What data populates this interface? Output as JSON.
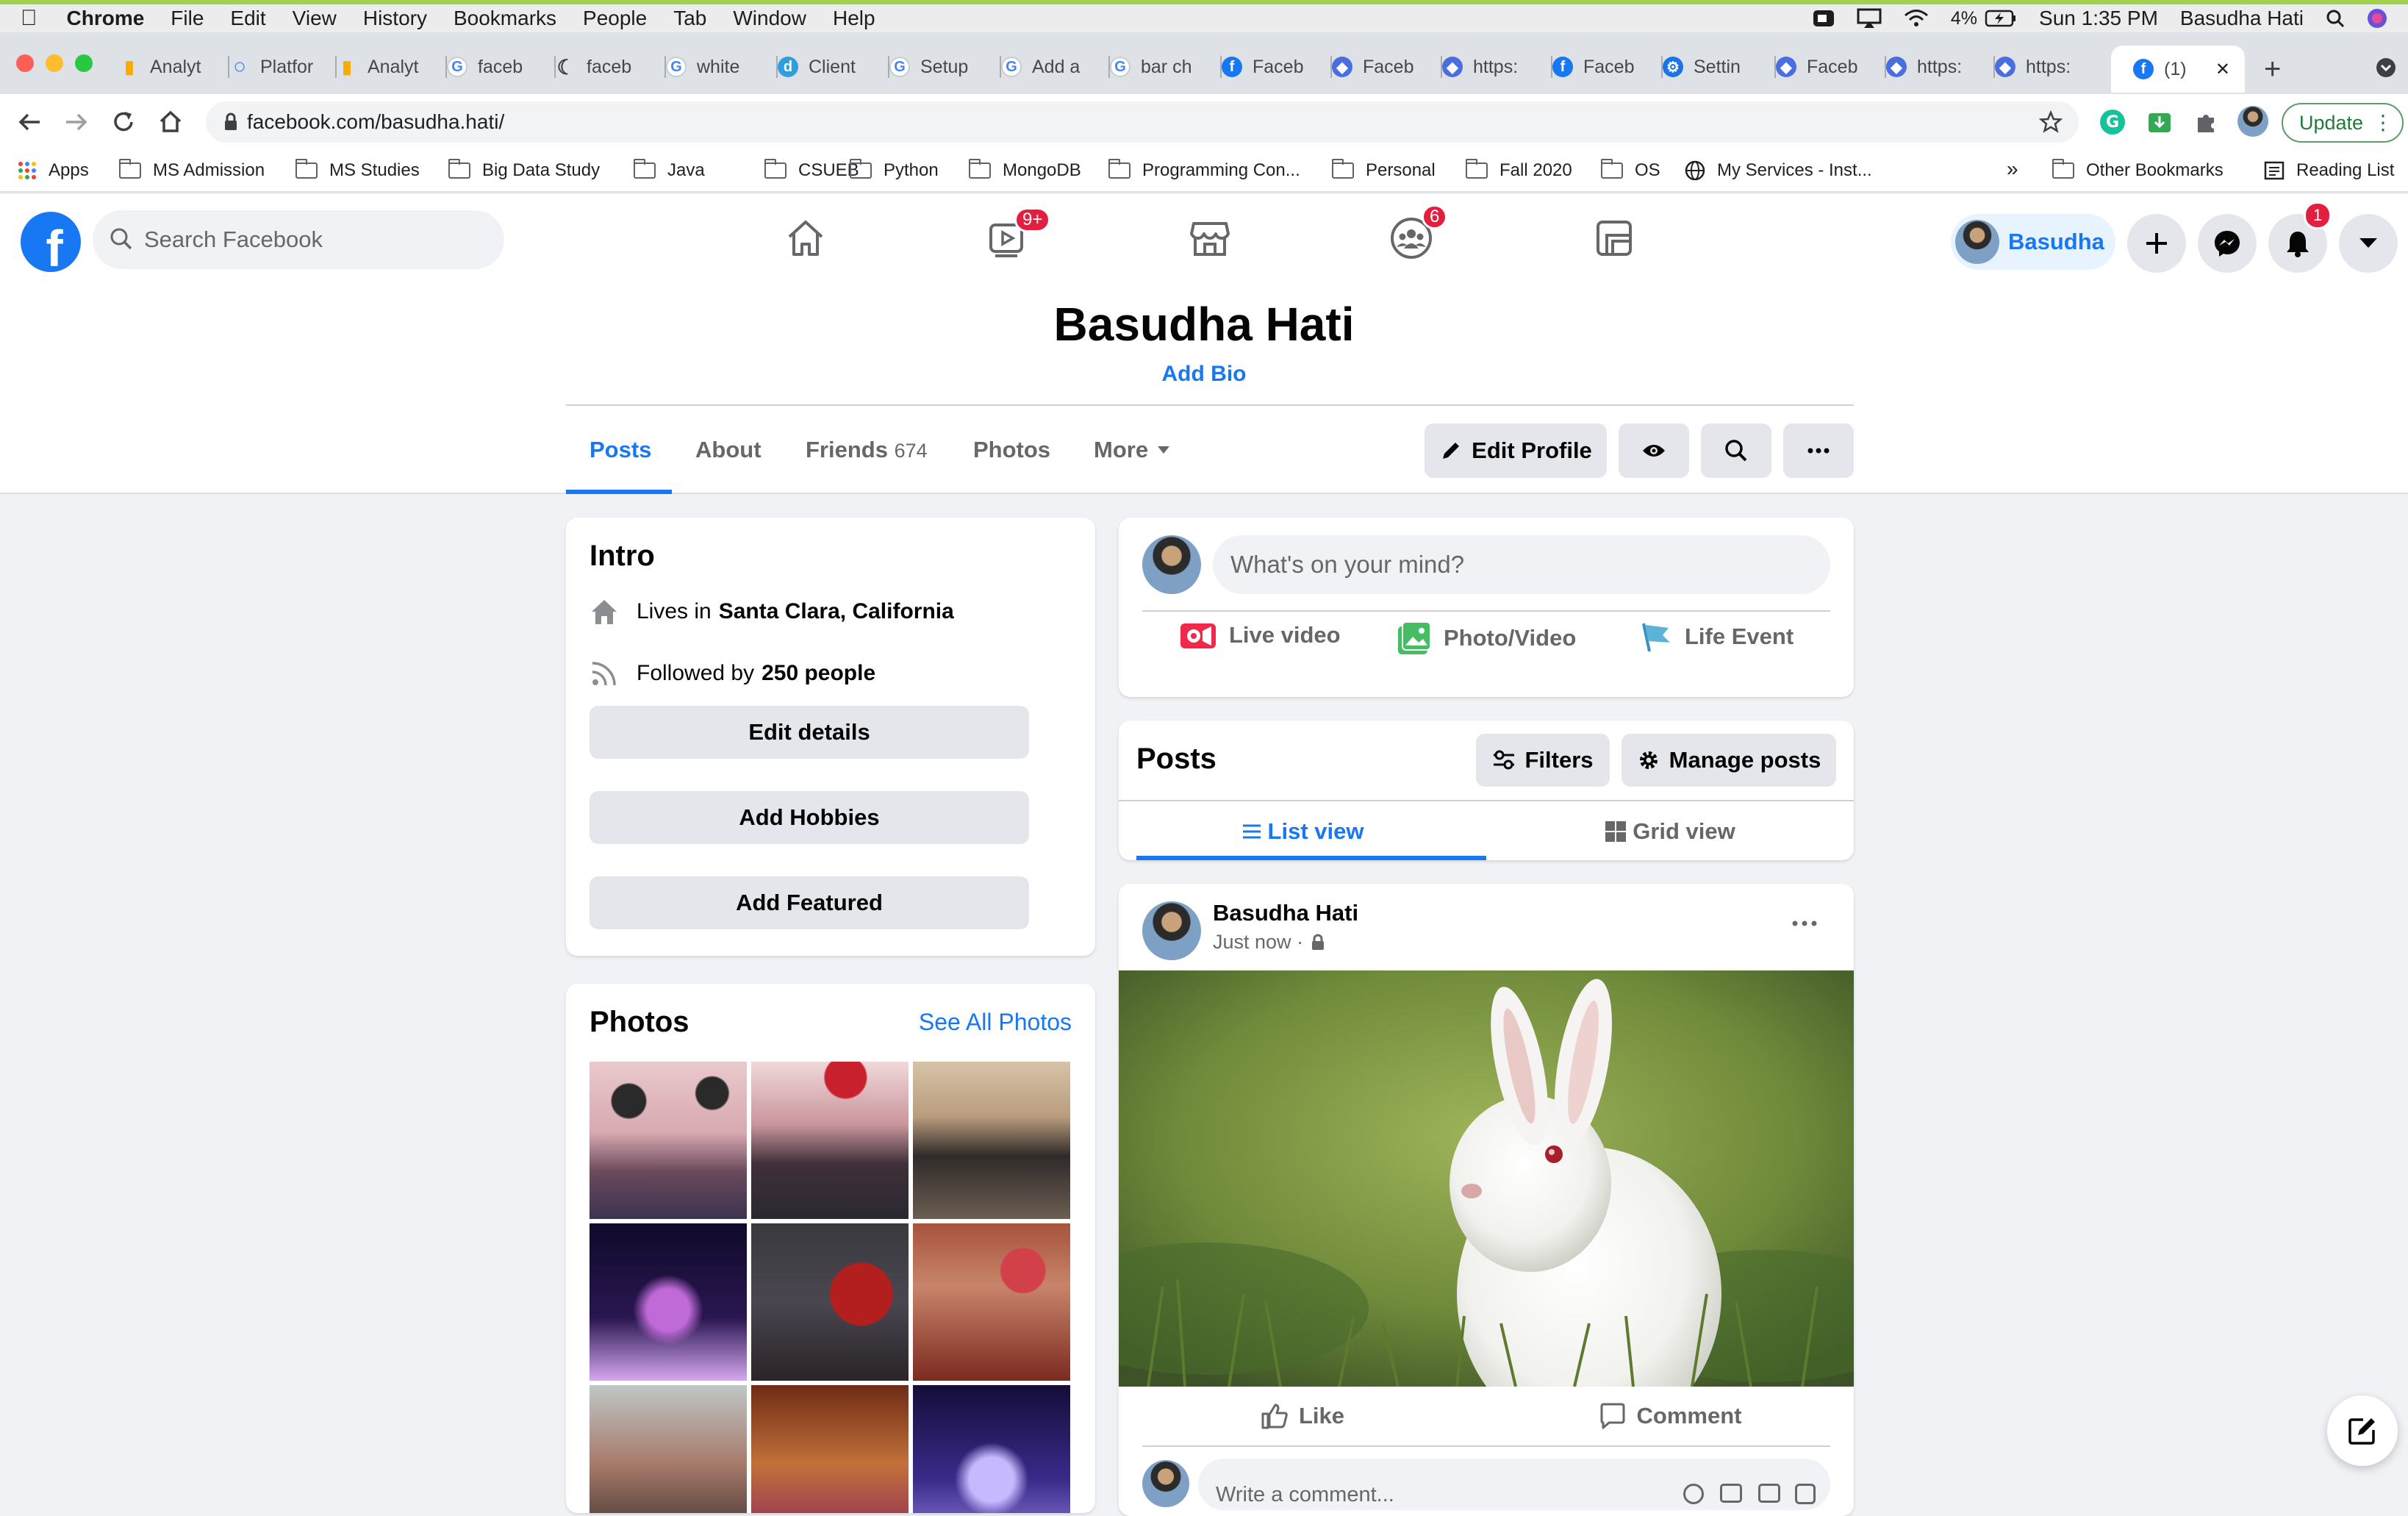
{
  "menubar": {
    "app": "Chrome",
    "items": [
      "File",
      "Edit",
      "View",
      "History",
      "Bookmarks",
      "People",
      "Tab",
      "Window",
      "Help"
    ],
    "battery": "4%",
    "datetime": "Sun 1:35 PM",
    "user": "Basudha Hati"
  },
  "tabs": [
    {
      "title": "Analyt",
      "icon": "analytics-icon",
      "color": "#f9ab00"
    },
    {
      "title": "Platfor",
      "icon": "ring-icon",
      "color": "#4285f4"
    },
    {
      "title": "Analyt",
      "icon": "analytics-icon",
      "color": "#f9ab00"
    },
    {
      "title": "faceb",
      "icon": "google-icon",
      "color": "#4285f4"
    },
    {
      "title": "faceb",
      "icon": "crescent-icon",
      "color": "#3c4043"
    },
    {
      "title": "white",
      "icon": "google-icon",
      "color": "#4285f4"
    },
    {
      "title": "Client",
      "icon": "d-icon",
      "color": "#2d9ee0"
    },
    {
      "title": "Setup",
      "icon": "google-icon",
      "color": "#4285f4"
    },
    {
      "title": "Add a",
      "icon": "google-icon",
      "color": "#4285f4"
    },
    {
      "title": "bar ch",
      "icon": "google-icon",
      "color": "#4285f4"
    },
    {
      "title": "Faceb",
      "icon": "facebook-icon",
      "color": "#1877f2"
    },
    {
      "title": "Faceb",
      "icon": "diamond-icon",
      "color": "#4a6ee0"
    },
    {
      "title": "https:",
      "icon": "diamond-icon",
      "color": "#4a6ee0"
    },
    {
      "title": "Faceb",
      "icon": "facebook-icon",
      "color": "#1877f2"
    },
    {
      "title": "Settin",
      "icon": "gear-icon",
      "color": "#1a73e8"
    },
    {
      "title": "Faceb",
      "icon": "diamond-icon",
      "color": "#4a6ee0"
    },
    {
      "title": "https:",
      "icon": "diamond-icon",
      "color": "#4a6ee0"
    },
    {
      "title": "https:",
      "icon": "diamond-icon",
      "color": "#4a6ee0"
    },
    {
      "title": "(1)",
      "icon": "facebook-icon",
      "color": "#1877f2",
      "active": true
    }
  ],
  "address": {
    "url": "facebook.com/basudha.hati/",
    "update_label": "Update"
  },
  "bookmarks": {
    "apps": "Apps",
    "items": [
      "MS Admission",
      "MS Studies",
      "Big Data Study",
      "Java",
      "CSUEB",
      "Python",
      "MongoDB",
      "Programming Con...",
      "Personal",
      "Fall 2020",
      "OS"
    ],
    "services": "My Services - Inst...",
    "more": "»",
    "other": "Other Bookmarks",
    "reading": "Reading List"
  },
  "fb": {
    "search_placeholder": "Search Facebook",
    "watch_badge": "9+",
    "groups_badge": "6",
    "notif_badge": "1",
    "profile_chip": "Basudha",
    "brand_color": "#1877f2"
  },
  "profile": {
    "name": "Basudha Hati",
    "add_bio": "Add Bio",
    "tabs": [
      {
        "label": "Posts"
      },
      {
        "label": "About"
      },
      {
        "label": "Friends",
        "count": "674"
      },
      {
        "label": "Photos"
      },
      {
        "label": "More"
      }
    ],
    "edit_profile": "Edit Profile"
  },
  "intro": {
    "title": "Intro",
    "lives_prefix": "Lives in",
    "lives_place": "Santa Clara, California",
    "followed_prefix": "Followed by",
    "followed_count": "250 people",
    "buttons": [
      "Edit details",
      "Add Hobbies",
      "Add Featured"
    ]
  },
  "photos": {
    "title": "Photos",
    "see_all": "See All Photos"
  },
  "composer": {
    "placeholder": "What's on your mind?",
    "actions": [
      "Live video",
      "Photo/Video",
      "Life Event"
    ]
  },
  "posts": {
    "title": "Posts",
    "filters": "Filters",
    "manage": "Manage posts",
    "list_view": "List view",
    "grid_view": "Grid view"
  },
  "post": {
    "author": "Basudha Hati",
    "time": "Just now ·",
    "like": "Like",
    "comment": "Comment",
    "comment_placeholder": "Write a comment..."
  }
}
